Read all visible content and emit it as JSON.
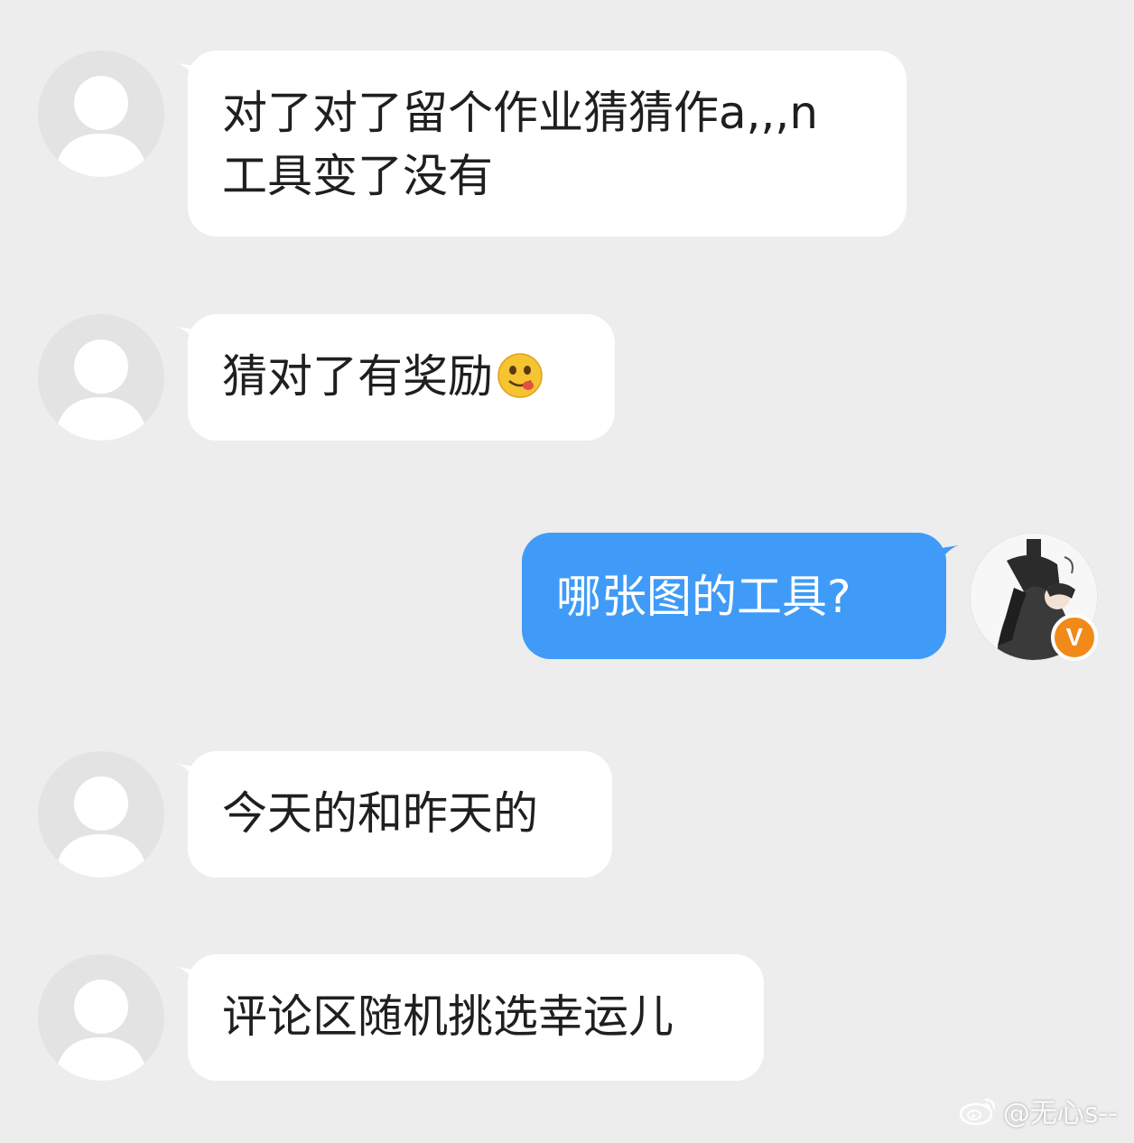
{
  "messages": [
    {
      "direction": "in",
      "lines": [
        "对了对了留个作业猜猜作a,,,n",
        "工具变了没有"
      ]
    },
    {
      "direction": "in",
      "text": "猜对了有奖励",
      "emoji": "yum-face-emoji"
    },
    {
      "direction": "out",
      "text": "哪张图的工具?"
    },
    {
      "direction": "in",
      "text": "今天的和昨天的"
    },
    {
      "direction": "in",
      "text": "评论区随机挑选幸运儿"
    }
  ],
  "self_avatar": {
    "badge": "V"
  },
  "watermark": {
    "text": "@无心s--",
    "icon": "weibo-icon"
  },
  "colors": {
    "background": "#ededed",
    "incoming_bubble": "#ffffff",
    "outgoing_bubble": "#3f9bf7",
    "badge": "#f28a1a"
  }
}
